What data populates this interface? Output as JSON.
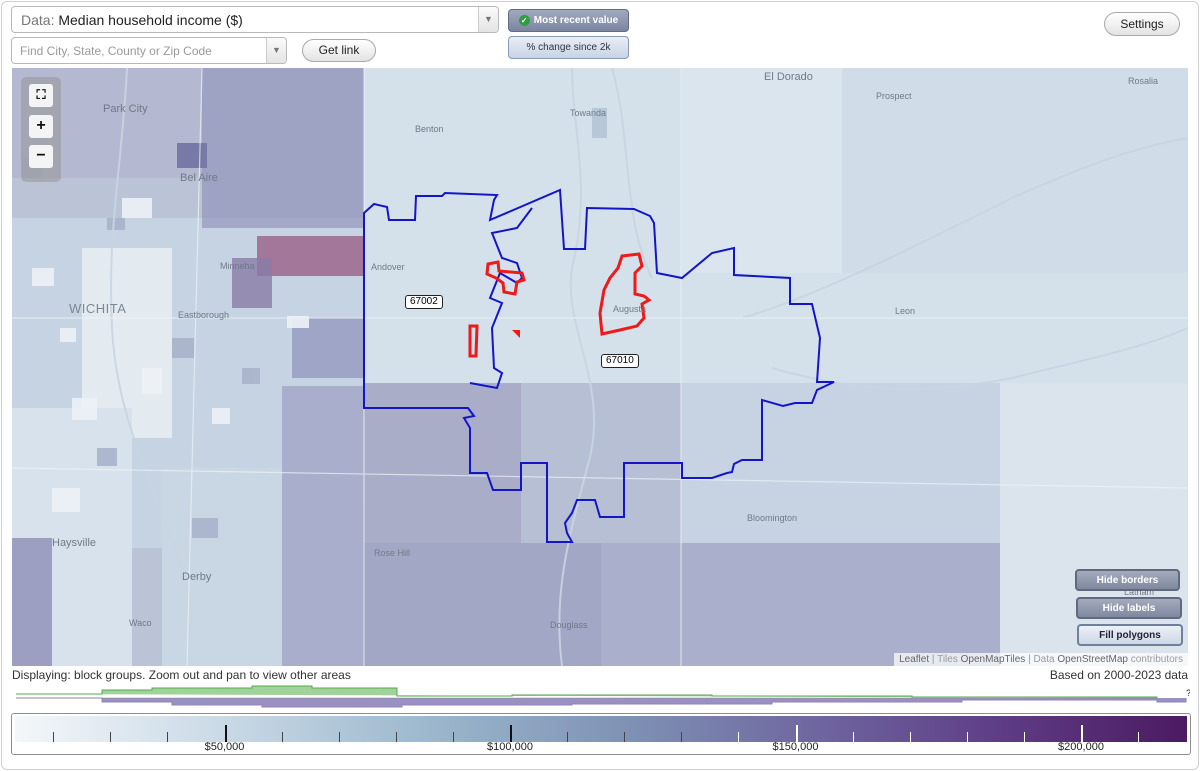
{
  "header": {
    "data_prefix": "Data:",
    "data_value": "Median household income ($)",
    "search_placeholder": "Find City, State, County or Zip Code",
    "get_link": "Get link",
    "most_recent": "Most recent value",
    "pct_change": "% change since 2k",
    "settings": "Settings"
  },
  "map": {
    "places": {
      "el_dorado": "El Dorado",
      "rosalia": "Rosalia",
      "prospect": "Prospect",
      "park_city": "Park City",
      "towanda": "Towanda",
      "benton": "Benton",
      "bel_aire": "Bel Aire",
      "andover": "Andover",
      "minneha": "Minneha",
      "wichita": "WICHITA",
      "eastborough": "Eastborough",
      "augusta": "Augusta",
      "leon": "Leon",
      "bloomington": "Bloomington",
      "haysville": "Haysville",
      "rose_hill": "Rose Hill",
      "derby": "Derby",
      "waco": "Waco",
      "douglass": "Douglass",
      "latham": "Latham"
    },
    "zip_labels": [
      "67002",
      "67010"
    ],
    "zoom": {
      "fit": "⛶",
      "in": "+",
      "out": "−"
    },
    "buttons": {
      "hide_borders": "Hide borders",
      "hide_labels": "Hide labels",
      "fill_polygons": "Fill polygons"
    },
    "attribution": {
      "leaflet": "Leaflet",
      "sep1": " | Tiles ",
      "tiles": "OpenMapTiles",
      "sep2": " | Data ",
      "data": "OpenStreetMap",
      "contrib": " contributors"
    }
  },
  "status": {
    "displaying": "Displaying: block groups. Zoom out and pan to view other areas",
    "based_on": "Based on 2000-2023 data",
    "help": "?"
  },
  "legend": {
    "labels": [
      "$50,000",
      "$100,000",
      "$150,000",
      "$200,000"
    ],
    "values": [
      50000,
      100000,
      150000,
      200000
    ]
  },
  "colors": {
    "border_zip": "#1515c8",
    "border_place": "#ee1a1a",
    "hist_green": "#56a84d",
    "hist_purple": "#8f84b8"
  }
}
